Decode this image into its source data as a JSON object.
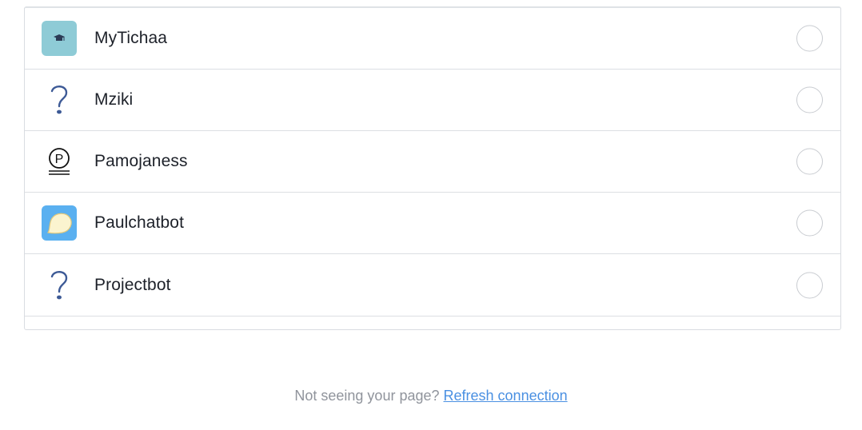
{
  "pages": [
    {
      "name": "MyTichaa",
      "icon": "graduation-cap-icon"
    },
    {
      "name": "Mziki",
      "icon": "question-mark-icon"
    },
    {
      "name": "Pamojaness",
      "icon": "p-logo-icon"
    },
    {
      "name": "Paulchatbot",
      "icon": "speech-bubble-icon"
    },
    {
      "name": "Projectbot",
      "icon": "question-mark-icon"
    }
  ],
  "footer": {
    "prompt": "Not seeing your page?",
    "link": "Refresh connection"
  },
  "colors": {
    "link": "#4a90e2",
    "mytichaa_bg": "#8ecbd6",
    "paulchatbot_bg": "#5ab0f0",
    "question_mark": "#3d5a96"
  }
}
